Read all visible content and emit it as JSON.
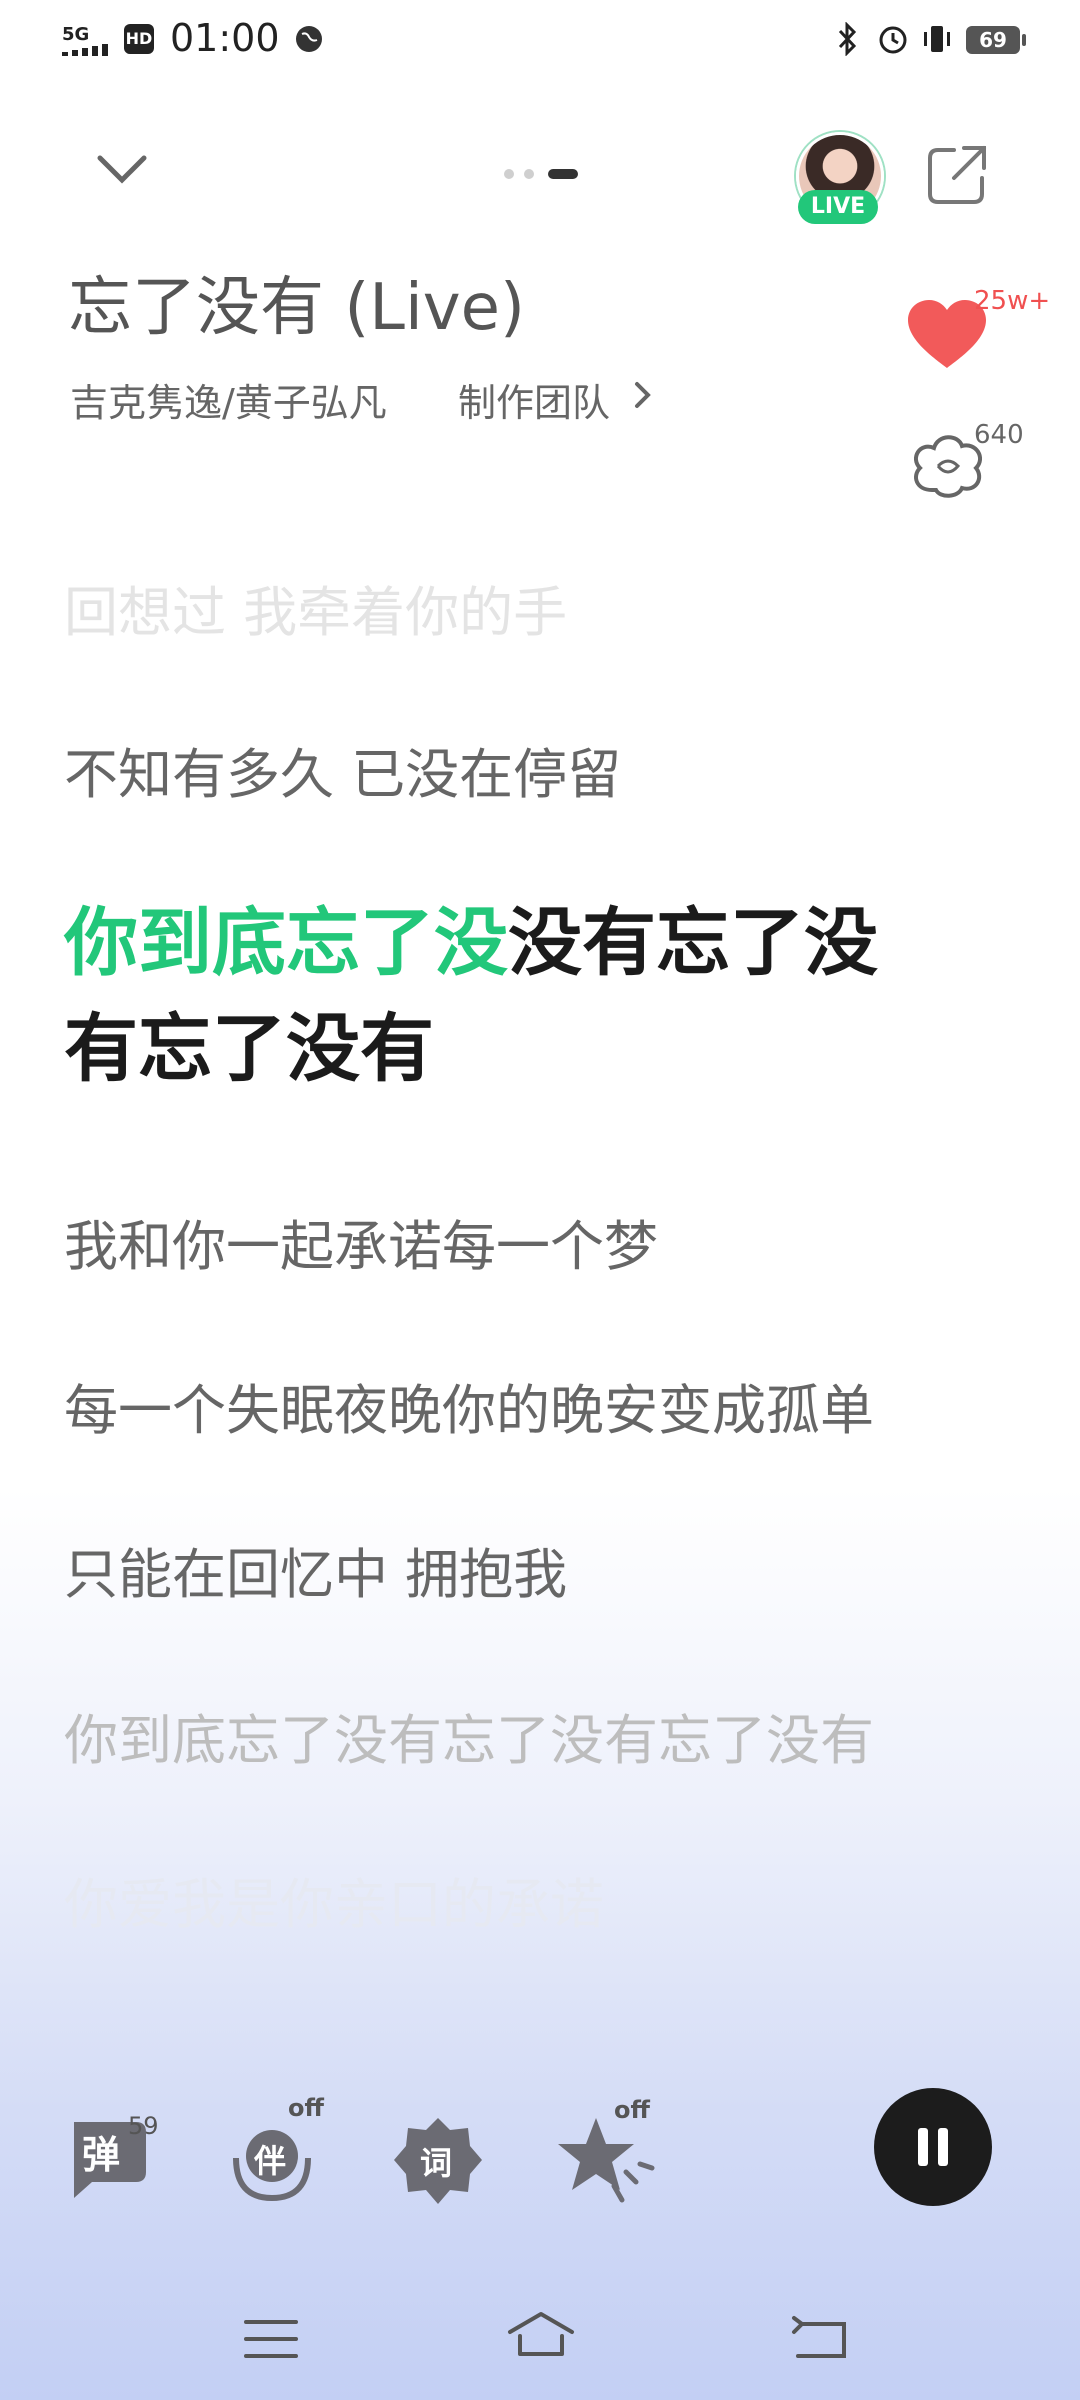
{
  "status_bar": {
    "network": "5G",
    "hd": "HD",
    "time": "01:00",
    "battery": "69"
  },
  "header": {
    "live_badge": "LIVE"
  },
  "song": {
    "title": "忘了没有 (Live)",
    "artists": "吉克隽逸/黄子弘凡",
    "production_team": "制作团队"
  },
  "actions": {
    "like_count": "25w+",
    "comment_count": "640"
  },
  "lyrics": {
    "prev2": "回想过 我牵着你的手",
    "prev1": "不知有多久 已没在停留",
    "current_sung": "你到底忘了没",
    "current_rest": "没有忘了没有忘了没有",
    "next1": "我和你一起承诺每一个梦",
    "next2": "每一个失眠夜晚你的晚安变成孤单",
    "next3": "只能在回忆中 拥抱我",
    "next4": "你到底忘了没有忘了没有忘了没有",
    "next5": "你爱我是你亲口的承诺"
  },
  "toolbar": {
    "danmaku_label": "弹",
    "danmaku_count": "59",
    "accompany_label": "伴",
    "accompany_state": "off",
    "lyrics_label": "词",
    "effect_state": "off"
  },
  "colors": {
    "accent": "#22c77a",
    "like": "#f05050"
  }
}
